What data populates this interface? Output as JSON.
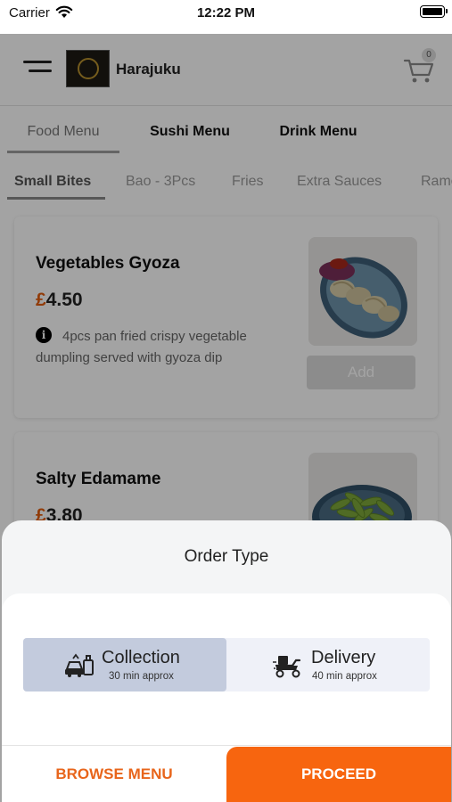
{
  "status_bar": {
    "carrier": "Carrier",
    "time": "12:22 PM"
  },
  "header": {
    "brand_name": "Harajuku",
    "cart_count": "0"
  },
  "menu_tabs": [
    {
      "label": "Food Menu",
      "active": true
    },
    {
      "label": "Sushi Menu",
      "active": false
    },
    {
      "label": "Drink Menu",
      "active": false
    }
  ],
  "category_tabs": [
    {
      "label": "Small Bites",
      "active": true
    },
    {
      "label": "Bao - 3Pcs",
      "active": false
    },
    {
      "label": "Fries",
      "active": false
    },
    {
      "label": "Extra Sauces",
      "active": false
    },
    {
      "label": "Ramen",
      "active": false
    }
  ],
  "items": [
    {
      "name": "Vegetables Gyoza",
      "currency": "£",
      "price": "4.50",
      "description": "4pcs pan fried crispy vegetable dumpling served with gyoza dip",
      "add_label": "Add"
    },
    {
      "name": "Salty Edamame",
      "currency": "£",
      "price": "3.80"
    }
  ],
  "order_sheet": {
    "title": "Order Type",
    "options": [
      {
        "label": "Collection",
        "sub": "30 min approx",
        "selected": true
      },
      {
        "label": "Delivery",
        "sub": "40 min approx",
        "selected": false
      }
    ],
    "browse_label": "BROWSE MENU",
    "proceed_label": "PROCEED"
  },
  "colors": {
    "accent_orange": "#f7650f",
    "selected_option": "#c3cbdd",
    "currency": "#e35d0e"
  }
}
